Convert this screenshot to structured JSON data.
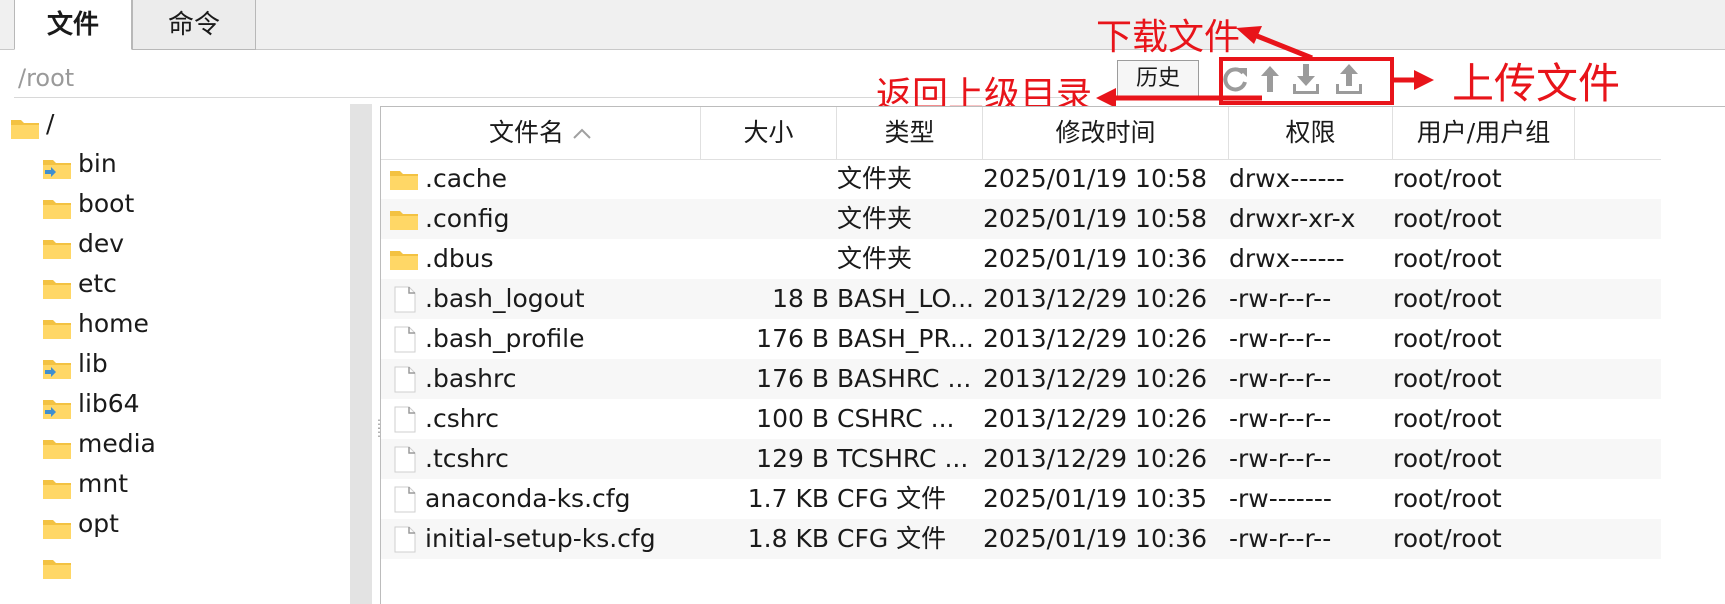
{
  "tabs": [
    {
      "label": "文件",
      "active": true
    },
    {
      "label": "命令",
      "active": false
    }
  ],
  "path": {
    "value": "/root"
  },
  "history_button": "历史",
  "toolbar_icons": [
    "refresh-icon",
    "up-directory-icon",
    "download-icon",
    "upload-icon"
  ],
  "annotations": {
    "download": "下载文件",
    "parent": "返回上级目录",
    "upload": "上传文件",
    "color": "#e8141a"
  },
  "tree": [
    {
      "label": "/",
      "level": 0,
      "type": "folder"
    },
    {
      "label": "bin",
      "level": 1,
      "type": "link-folder"
    },
    {
      "label": "boot",
      "level": 1,
      "type": "folder"
    },
    {
      "label": "dev",
      "level": 1,
      "type": "folder"
    },
    {
      "label": "etc",
      "level": 1,
      "type": "folder"
    },
    {
      "label": "home",
      "level": 1,
      "type": "folder"
    },
    {
      "label": "lib",
      "level": 1,
      "type": "link-folder"
    },
    {
      "label": "lib64",
      "level": 1,
      "type": "link-folder"
    },
    {
      "label": "media",
      "level": 1,
      "type": "folder"
    },
    {
      "label": "mnt",
      "level": 1,
      "type": "folder"
    },
    {
      "label": "opt",
      "level": 1,
      "type": "folder"
    }
  ],
  "columns": [
    "文件名",
    "大小",
    "类型",
    "修改时间",
    "权限",
    "用户/用户组"
  ],
  "sort": {
    "column": "文件名",
    "direction": "ascending"
  },
  "files": [
    {
      "name": ".cache",
      "size": "",
      "type": "文件夹",
      "mtime": "2025/01/19 10:58",
      "perm": "drwx------",
      "owner": "root/root",
      "kind": "folder"
    },
    {
      "name": ".config",
      "size": "",
      "type": "文件夹",
      "mtime": "2025/01/19 10:58",
      "perm": "drwxr-xr-x",
      "owner": "root/root",
      "kind": "folder"
    },
    {
      "name": ".dbus",
      "size": "",
      "type": "文件夹",
      "mtime": "2025/01/19 10:36",
      "perm": "drwx------",
      "owner": "root/root",
      "kind": "folder"
    },
    {
      "name": ".bash_logout",
      "size": "18 B",
      "type": "BASH_LO...",
      "mtime": "2013/12/29 10:26",
      "perm": "-rw-r--r--",
      "owner": "root/root",
      "kind": "file"
    },
    {
      "name": ".bash_profile",
      "size": "176 B",
      "type": "BASH_PR...",
      "mtime": "2013/12/29 10:26",
      "perm": "-rw-r--r--",
      "owner": "root/root",
      "kind": "file"
    },
    {
      "name": ".bashrc",
      "size": "176 B",
      "type": "BASHRC ...",
      "mtime": "2013/12/29 10:26",
      "perm": "-rw-r--r--",
      "owner": "root/root",
      "kind": "file"
    },
    {
      "name": ".cshrc",
      "size": "100 B",
      "type": "CSHRC ...",
      "mtime": "2013/12/29 10:26",
      "perm": "-rw-r--r--",
      "owner": "root/root",
      "kind": "file"
    },
    {
      "name": ".tcshrc",
      "size": "129 B",
      "type": "TCSHRC ...",
      "mtime": "2013/12/29 10:26",
      "perm": "-rw-r--r--",
      "owner": "root/root",
      "kind": "file"
    },
    {
      "name": "anaconda-ks.cfg",
      "size": "1.7 KB",
      "type": "CFG 文件",
      "mtime": "2025/01/19 10:35",
      "perm": "-rw-------",
      "owner": "root/root",
      "kind": "file"
    },
    {
      "name": "initial-setup-ks.cfg",
      "size": "1.8 KB",
      "type": "CFG 文件",
      "mtime": "2025/01/19 10:36",
      "perm": "-rw-r--r--",
      "owner": "root/root",
      "kind": "file"
    }
  ]
}
